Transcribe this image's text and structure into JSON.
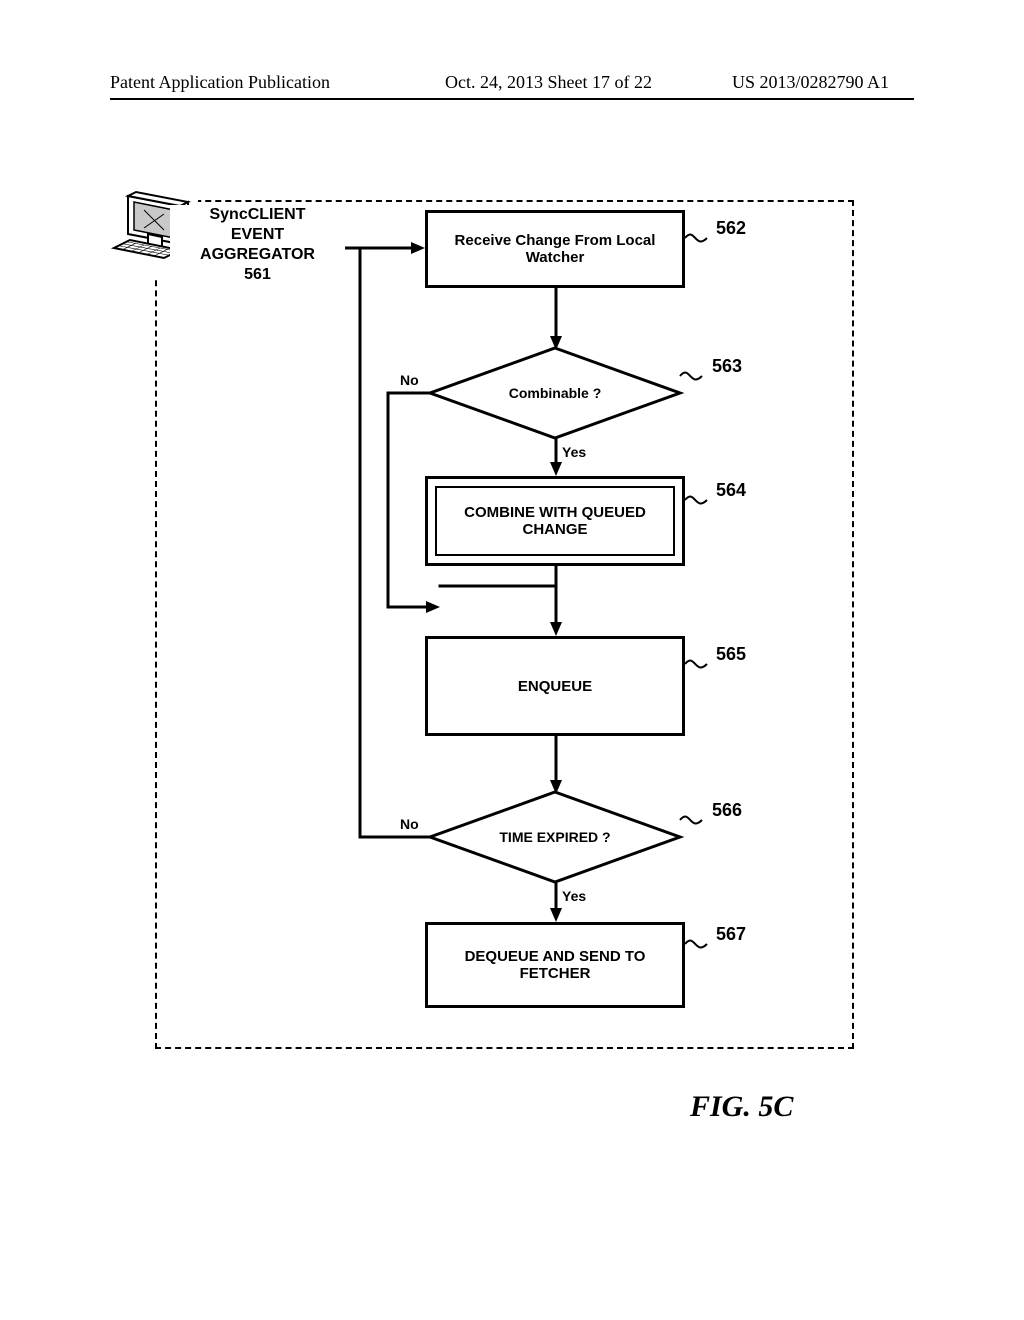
{
  "header": {
    "left": "Patent Application Publication",
    "mid": "Oct. 24, 2013  Sheet 17 of 22",
    "right": "US 2013/0282790 A1"
  },
  "title": {
    "line1": "SyncCLIENT",
    "line2": "EVENT",
    "line3": "AGGREGATOR",
    "line4": "561"
  },
  "nodes": {
    "n562": "Receive Change From Local Watcher",
    "n563": "Combinable ?",
    "n564": "COMBINE WITH QUEUED CHANGE",
    "n565": "ENQUEUE",
    "n566": "TIME EXPIRED ?",
    "n567": "DEQUEUE AND SEND TO FETCHER"
  },
  "refs": {
    "r562": "562",
    "r563": "563",
    "r564": "564",
    "r565": "565",
    "r566": "566",
    "r567": "567"
  },
  "edges": {
    "yes": "Yes",
    "no": "No"
  },
  "figure_label": "FIG. 5C"
}
